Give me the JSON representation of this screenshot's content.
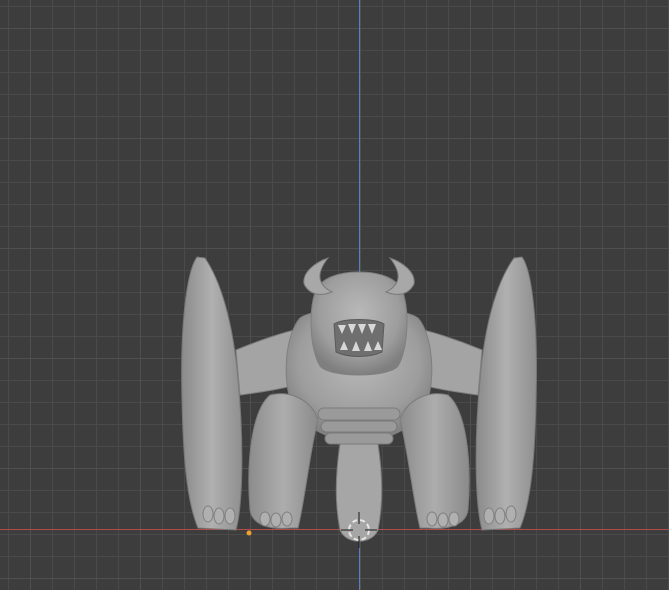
{
  "viewport": {
    "colors": {
      "background": "#3d3d3d",
      "grid_line": "#4a4a4a",
      "axis_x": "#b34b4b",
      "axis_z": "#5b7fb8",
      "mesh": "#9c9c9c",
      "cursor_ring": "#e8e8e8",
      "cursor_dash": "#d83a3a",
      "origin_dot": "#f0a030"
    },
    "icons": {
      "cursor": "3d-cursor-icon",
      "origin": "object-origin-icon"
    }
  }
}
